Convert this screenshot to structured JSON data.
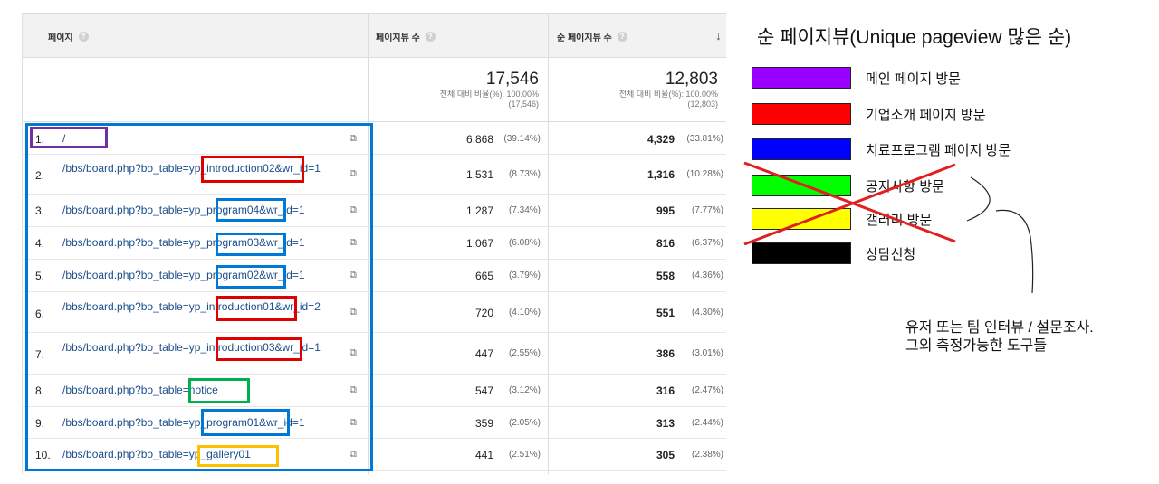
{
  "table": {
    "columns": {
      "page": "페이지",
      "pageviews": "페이지뷰 수",
      "unique_pageviews": "순 페이지뷰 수",
      "help_icon": "?",
      "sort_icon": "↓"
    },
    "totals": {
      "pageviews": {
        "value": "17,546",
        "pct_line": "전체 대비 비율(%): 100.00%",
        "abs": "(17,546)"
      },
      "unique_pageviews": {
        "value": "12,803",
        "pct_line": "전체 대비 비율(%): 100.00%",
        "abs": "(12,803)"
      }
    },
    "rows": [
      {
        "num": "1.",
        "page": "/",
        "pv": "6,868",
        "pv_pct": "(39.14%)",
        "upv": "4,329",
        "upv_pct": "(33.81%)"
      },
      {
        "num": "2.",
        "page": "/bbs/board.php?bo_table=yp_introduction02&wr_id=1",
        "pv": "1,531",
        "pv_pct": "(8.73%)",
        "upv": "1,316",
        "upv_pct": "(10.28%)"
      },
      {
        "num": "3.",
        "page": "/bbs/board.php?bo_table=yp_program04&wr_id=1",
        "pv": "1,287",
        "pv_pct": "(7.34%)",
        "upv": "995",
        "upv_pct": "(7.77%)"
      },
      {
        "num": "4.",
        "page": "/bbs/board.php?bo_table=yp_program03&wr_id=1",
        "pv": "1,067",
        "pv_pct": "(6.08%)",
        "upv": "816",
        "upv_pct": "(6.37%)"
      },
      {
        "num": "5.",
        "page": "/bbs/board.php?bo_table=yp_program02&wr_id=1",
        "pv": "665",
        "pv_pct": "(3.79%)",
        "upv": "558",
        "upv_pct": "(4.36%)"
      },
      {
        "num": "6.",
        "page": "/bbs/board.php?bo_table=yp_introduction01&wr_id=2",
        "pv": "720",
        "pv_pct": "(4.10%)",
        "upv": "551",
        "upv_pct": "(4.30%)"
      },
      {
        "num": "7.",
        "page": "/bbs/board.php?bo_table=yp_introduction03&wr_id=1",
        "pv": "447",
        "pv_pct": "(2.55%)",
        "upv": "386",
        "upv_pct": "(3.01%)"
      },
      {
        "num": "8.",
        "page": "/bbs/board.php?bo_table=notice",
        "pv": "547",
        "pv_pct": "(3.12%)",
        "upv": "316",
        "upv_pct": "(2.47%)"
      },
      {
        "num": "9.",
        "page": "/bbs/board.php?bo_table=yp_program01&wr_id=1",
        "pv": "359",
        "pv_pct": "(2.05%)",
        "upv": "313",
        "upv_pct": "(2.44%)"
      },
      {
        "num": "10.",
        "page": "/bbs/board.php?bo_table=yp_gallery01",
        "pv": "441",
        "pv_pct": "(2.51%)",
        "upv": "305",
        "upv_pct": "(2.38%)"
      }
    ],
    "link_icon": "⧉"
  },
  "legend": {
    "title": "순 페이지뷰(Unique pageview 많은 순)",
    "items": [
      {
        "label": "메인 페이지 방문",
        "color": "#9900ff"
      },
      {
        "label": "기업소개 페이지 방문",
        "color": "#ff0000"
      },
      {
        "label": "치료프로그램 페이지 방문",
        "color": "#0000ff"
      },
      {
        "label": "공지사항 방문",
        "color": "#00ff00"
      },
      {
        "label": "갤러리 방문",
        "color": "#ffff00"
      },
      {
        "label": "상담신청",
        "color": "#000000"
      }
    ],
    "note_line1": "유저 또는 팀 인터뷰 / 설문조사.",
    "note_line2": "그외 측정가능한 도구들"
  },
  "annotation_colors": {
    "purple": "#7030a0",
    "red": "#e00000",
    "blue": "#0078d7",
    "green": "#00b050",
    "yellow": "#ffc000",
    "cross": "#e02020"
  }
}
